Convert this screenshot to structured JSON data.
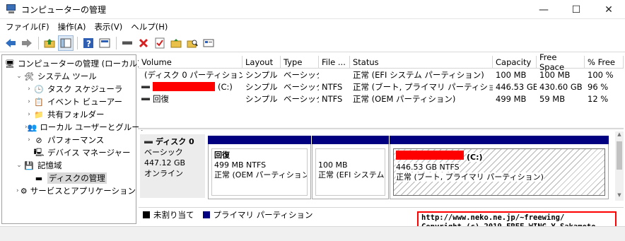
{
  "window": {
    "title": "コンピューターの管理",
    "minimize": "—",
    "maximize": "☐",
    "close": "✕"
  },
  "menu": [
    "ファイル(F)",
    "操作(A)",
    "表示(V)",
    "ヘルプ(H)"
  ],
  "toolbar": {
    "icons": [
      "back-arrow-icon",
      "forward-arrow-icon",
      "up-folder-icon",
      "show-hide-tree-icon",
      "help-icon",
      "properties-icon",
      "connect-icon",
      "delete-icon",
      "check-icon",
      "folder-up-icon",
      "search-icon",
      "export-icon"
    ]
  },
  "tree": {
    "items": [
      {
        "label": "コンピューターの管理 (ローカル)",
        "indent": 0,
        "chev": "",
        "icon": "🖥"
      },
      {
        "label": "システム ツール",
        "indent": 1,
        "chev": "⌄",
        "icon": "🛠"
      },
      {
        "label": "タスク スケジューラ",
        "indent": 2,
        "chev": "›",
        "icon": "🕒"
      },
      {
        "label": "イベント ビューアー",
        "indent": 2,
        "chev": "›",
        "icon": "📋"
      },
      {
        "label": "共有フォルダー",
        "indent": 2,
        "chev": "›",
        "icon": "📁"
      },
      {
        "label": "ローカル ユーザーとグループ",
        "indent": 2,
        "chev": "›",
        "icon": "👥"
      },
      {
        "label": "パフォーマンス",
        "indent": 2,
        "chev": "›",
        "icon": "⊘"
      },
      {
        "label": "デバイス マネージャー",
        "indent": 2,
        "chev": "",
        "icon": "🖳"
      },
      {
        "label": "記憶域",
        "indent": 1,
        "chev": "⌄",
        "icon": "💾"
      },
      {
        "label": "ディスクの管理",
        "indent": 2,
        "chev": "",
        "icon": "▬",
        "selected": true
      },
      {
        "label": "サービスとアプリケーション",
        "indent": 1,
        "chev": "›",
        "icon": "⚙"
      }
    ]
  },
  "volumes": {
    "headers": [
      "Volume",
      "Layout",
      "Type",
      "File ...",
      "Status",
      "Capacity",
      "Free Space",
      "% Free"
    ],
    "rows": [
      {
        "volume": "(ディスク 0 パーティション 2)",
        "redacted": false,
        "layout": "シンプル",
        "type": "ベーシック",
        "fs": "",
        "status": "正常 (EFI システム パーティション)",
        "capacity": "100 MB",
        "free": "100 MB",
        "pct": "100 %"
      },
      {
        "volume": "(C:)",
        "redacted": true,
        "layout": "シンプル",
        "type": "ベーシック",
        "fs": "NTFS",
        "status": "正常 (ブート, プライマリ パーティション)",
        "capacity": "446.53 GB",
        "free": "430.60 GB",
        "pct": "96 %"
      },
      {
        "volume": "回復",
        "redacted": false,
        "layout": "シンプル",
        "type": "ベーシック",
        "fs": "NTFS",
        "status": "正常 (OEM パーティション)",
        "capacity": "499 MB",
        "free": "59 MB",
        "pct": "12 %"
      }
    ]
  },
  "disk": {
    "name": "ディスク 0",
    "type": "ベーシック",
    "size": "447.12 GB",
    "state": "オンライン",
    "partitions": [
      {
        "name": "回復",
        "size": "499 MB NTFS",
        "status": "正常 (OEM パーティション)"
      },
      {
        "name": "",
        "size": "100 MB",
        "status": "正常 (EFI システム /"
      },
      {
        "name": "(C:)",
        "size": "446.53 GB NTFS",
        "status": "正常 (ブート, プライマリ パーティション)"
      }
    ]
  },
  "legend": [
    {
      "label": "未割り当て",
      "color": "#000000"
    },
    {
      "label": "プライマリ パーティション",
      "color": "#000080"
    }
  ],
  "watermark": {
    "line1": "http://www.neko.ne.jp/~freewing/",
    "line2": "Copyright (c) 2019 FREE WING,Y.Sakamoto"
  },
  "colors": {
    "partition_bar": "#000080",
    "redaction": "#ff0000",
    "watermark_border": "#ff0000"
  }
}
